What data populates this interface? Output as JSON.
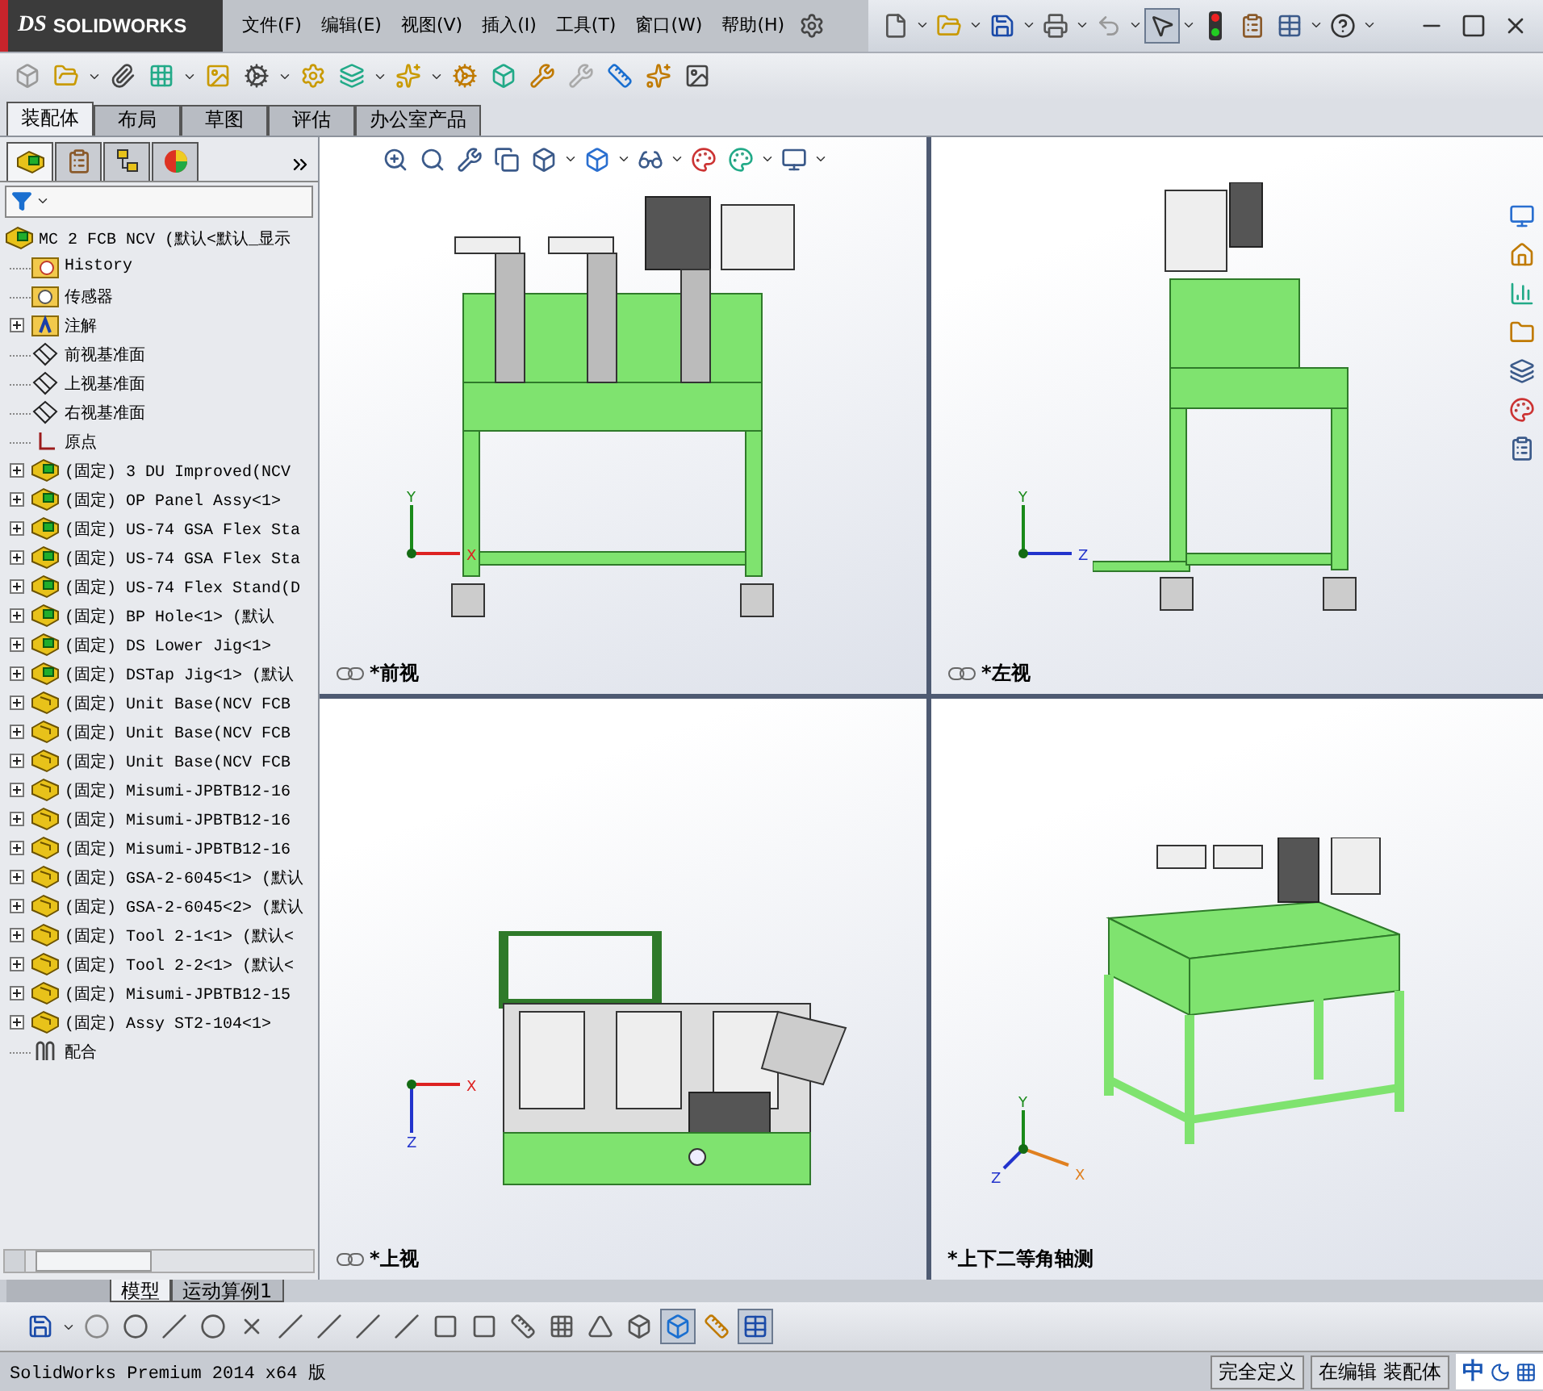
{
  "app": {
    "logo_mark": "DS",
    "logo_name": "SOLIDWORKS"
  },
  "menu": [
    "文件(F)",
    "编辑(E)",
    "视图(V)",
    "插入(I)",
    "工具(T)",
    "窗口(W)",
    "帮助(H)"
  ],
  "command_tabs": [
    {
      "label": "装配体",
      "selected": true
    },
    {
      "label": "布局",
      "selected": false
    },
    {
      "label": "草图",
      "selected": false
    },
    {
      "label": "评估",
      "selected": false
    },
    {
      "label": "办公室产品",
      "selected": false
    }
  ],
  "feature_manager": {
    "tabs": [
      {
        "kind": "tree",
        "selected": true
      },
      {
        "kind": "properties",
        "selected": false
      },
      {
        "kind": "config",
        "selected": false
      },
      {
        "kind": "display",
        "selected": false
      }
    ],
    "tree": {
      "label": "MC 2 FCB NCV  (默认<默认_显示",
      "kind": "assembly",
      "children": [
        {
          "label": "History",
          "kind": "history"
        },
        {
          "label": "传感器",
          "kind": "sensor"
        },
        {
          "label": "注解",
          "kind": "annotation",
          "expanded": false
        },
        {
          "label": "前视基准面",
          "kind": "plane"
        },
        {
          "label": "上视基准面",
          "kind": "plane"
        },
        {
          "label": "右视基准面",
          "kind": "plane"
        },
        {
          "label": "原点",
          "kind": "origin"
        },
        {
          "label": "(固定) 3 DU Improved(NCV",
          "kind": "assembly",
          "expanded": false
        },
        {
          "label": "(固定) OP Panel Assy<1>",
          "kind": "assembly",
          "expanded": false
        },
        {
          "label": "(固定) US-74 GSA Flex Sta",
          "kind": "assembly",
          "expanded": false
        },
        {
          "label": "(固定) US-74 GSA Flex Sta",
          "kind": "assembly",
          "expanded": false
        },
        {
          "label": "(固定) US-74 Flex Stand(D",
          "kind": "assembly",
          "expanded": false
        },
        {
          "label": "(固定) BP Hole<1> (默认",
          "kind": "assembly",
          "expanded": false
        },
        {
          "label": "(固定) DS Lower Jig<1>",
          "kind": "assembly",
          "expanded": false
        },
        {
          "label": "(固定) DSTap Jig<1> (默认",
          "kind": "assembly",
          "expanded": false
        },
        {
          "label": "(固定) Unit Base(NCV FCB",
          "kind": "part",
          "expanded": false
        },
        {
          "label": "(固定) Unit Base(NCV FCB",
          "kind": "part",
          "expanded": false
        },
        {
          "label": "(固定) Unit Base(NCV FCB",
          "kind": "part",
          "expanded": false
        },
        {
          "label": "(固定) Misumi-JPBTB12-16",
          "kind": "part",
          "expanded": false
        },
        {
          "label": "(固定) Misumi-JPBTB12-16",
          "kind": "part",
          "expanded": false
        },
        {
          "label": "(固定) Misumi-JPBTB12-16",
          "kind": "part",
          "expanded": false
        },
        {
          "label": "(固定) GSA-2-6045<1> (默认",
          "kind": "part",
          "expanded": false
        },
        {
          "label": "(固定) GSA-2-6045<2> (默认",
          "kind": "part",
          "expanded": false
        },
        {
          "label": "(固定) Tool 2-1<1> (默认<",
          "kind": "part",
          "expanded": false
        },
        {
          "label": "(固定) Tool 2-2<1> (默认<",
          "kind": "part",
          "expanded": false
        },
        {
          "label": "(固定) Misumi-JPBTB12-15",
          "kind": "part",
          "expanded": false
        },
        {
          "label": "(固定) Assy ST2-104<1>",
          "kind": "part",
          "expanded": false
        },
        {
          "label": "配合",
          "kind": "mates"
        }
      ]
    }
  },
  "viewports": [
    {
      "label": "*前视",
      "kind": "front",
      "linked": true,
      "axes": [
        "X",
        "Y"
      ]
    },
    {
      "label": "*左视",
      "kind": "left",
      "linked": true,
      "axes": [
        "Z",
        "Y"
      ]
    },
    {
      "label": "*上视",
      "kind": "top",
      "linked": true,
      "axes": [
        "X",
        "Z"
      ]
    },
    {
      "label": "*上下二等角轴测",
      "kind": "iso",
      "linked": false,
      "axes": [
        "X",
        "Y",
        "Z"
      ]
    }
  ],
  "bottom_tabs": [
    {
      "label": "模型",
      "selected": true
    },
    {
      "label": "运动算例1",
      "selected": false
    }
  ],
  "status": {
    "product": "SolidWorks Premium 2014 x64 版",
    "fields": [
      "完全定义",
      "在编辑 装配体"
    ],
    "ime": "中"
  }
}
